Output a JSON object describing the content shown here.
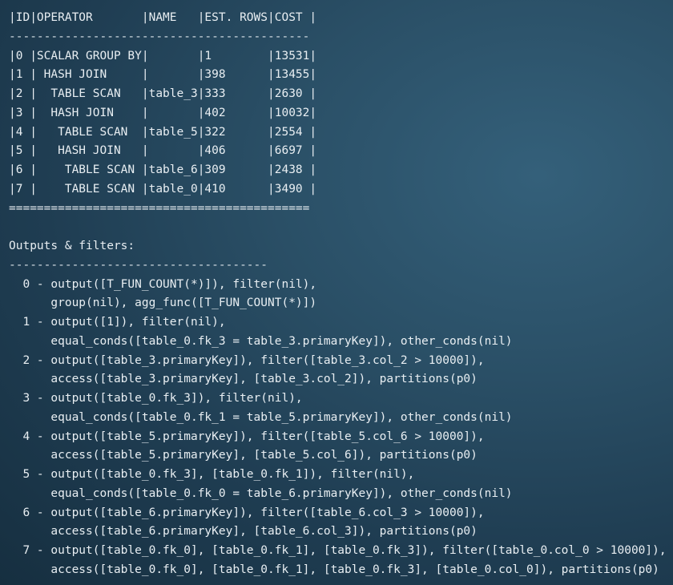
{
  "plan_table": {
    "header": "|ID|OPERATOR       |NAME   |EST. ROWS|COST |",
    "separator": "-------------------------------------------",
    "rows": [
      "|0 |SCALAR GROUP BY|       |1        |13531|",
      "|1 | HASH JOIN     |       |398      |13455|",
      "|2 |  TABLE SCAN   |table_3|333      |2630 |",
      "|3 |  HASH JOIN    |       |402      |10032|",
      "|4 |   TABLE SCAN  |table_5|322      |2554 |",
      "|5 |   HASH JOIN   |       |406      |6697 |",
      "|6 |    TABLE SCAN |table_6|309      |2438 |",
      "|7 |    TABLE SCAN |table_0|410      |3490 |"
    ],
    "footer": "==========================================="
  },
  "outputs": {
    "title": "Outputs & filters:",
    "separator": "-------------------------------------",
    "lines": [
      "  0 - output([T_FUN_COUNT(*)]), filter(nil),",
      "      group(nil), agg_func([T_FUN_COUNT(*)])",
      "  1 - output([1]), filter(nil),",
      "      equal_conds([table_0.fk_3 = table_3.primaryKey]), other_conds(nil)",
      "  2 - output([table_3.primaryKey]), filter([table_3.col_2 > 10000]),",
      "      access([table_3.primaryKey], [table_3.col_2]), partitions(p0)",
      "  3 - output([table_0.fk_3]), filter(nil),",
      "      equal_conds([table_0.fk_1 = table_5.primaryKey]), other_conds(nil)",
      "  4 - output([table_5.primaryKey]), filter([table_5.col_6 > 10000]),",
      "      access([table_5.primaryKey], [table_5.col_6]), partitions(p0)",
      "  5 - output([table_0.fk_3], [table_0.fk_1]), filter(nil),",
      "      equal_conds([table_0.fk_0 = table_6.primaryKey]), other_conds(nil)",
      "  6 - output([table_6.primaryKey]), filter([table_6.col_3 > 10000]),",
      "      access([table_6.primaryKey], [table_6.col_3]), partitions(p0)",
      "  7 - output([table_0.fk_0], [table_0.fk_1], [table_0.fk_3]), filter([table_0.col_0 > 10000]),",
      "      access([table_0.fk_0], [table_0.fk_1], [table_0.fk_3], [table_0.col_0]), partitions(p0)"
    ]
  }
}
